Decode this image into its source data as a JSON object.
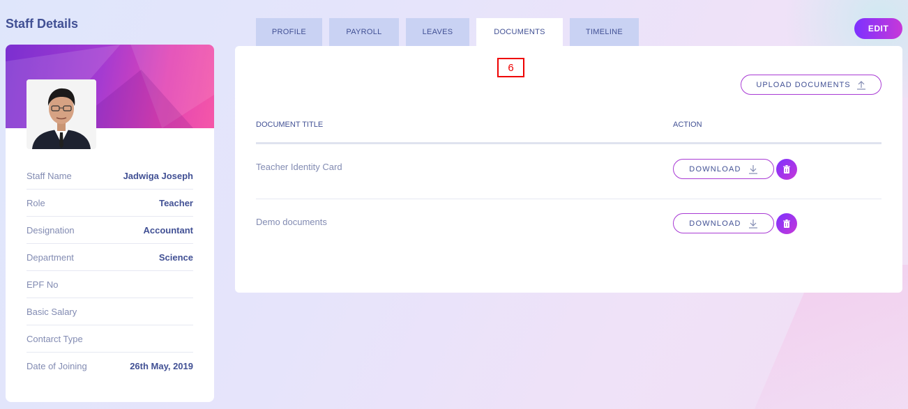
{
  "page": {
    "title": "Staff Details"
  },
  "profile": {
    "fields": [
      {
        "label": "Staff Name",
        "value": "Jadwiga Joseph"
      },
      {
        "label": "Role",
        "value": "Teacher"
      },
      {
        "label": "Designation",
        "value": "Accountant"
      },
      {
        "label": "Department",
        "value": "Science"
      },
      {
        "label": "EPF No",
        "value": ""
      },
      {
        "label": "Basic Salary",
        "value": ""
      },
      {
        "label": "Contarct Type",
        "value": ""
      },
      {
        "label": "Date of Joining",
        "value": "26th May, 2019"
      }
    ]
  },
  "tabs": [
    {
      "label": "PROFILE",
      "active": false
    },
    {
      "label": "PAYROLL",
      "active": false
    },
    {
      "label": "LEAVES",
      "active": false
    },
    {
      "label": "DOCUMENTS",
      "active": true
    },
    {
      "label": "TIMELINE",
      "active": false
    }
  ],
  "header": {
    "edit_label": "EDIT"
  },
  "annotation": {
    "marker_label": "6"
  },
  "documents": {
    "upload_label": "UPLOAD DOCUMENTS",
    "columns": {
      "title": "DOCUMENT TITLE",
      "action": "ACTION"
    },
    "rows": [
      {
        "title": "Teacher Identity Card",
        "download_label": "DOWNLOAD"
      },
      {
        "title": "Demo documents",
        "download_label": "DOWNLOAD"
      }
    ]
  },
  "colors": {
    "accent_start": "#7c32ff",
    "accent_end": "#c738d8",
    "text_primary": "#415094",
    "text_muted": "#828bb2",
    "tab_bg": "#c9d2f3",
    "annotation": "#ee0000"
  },
  "icons": {
    "upload": "upload-icon",
    "download": "download-icon",
    "delete": "trash-icon"
  }
}
